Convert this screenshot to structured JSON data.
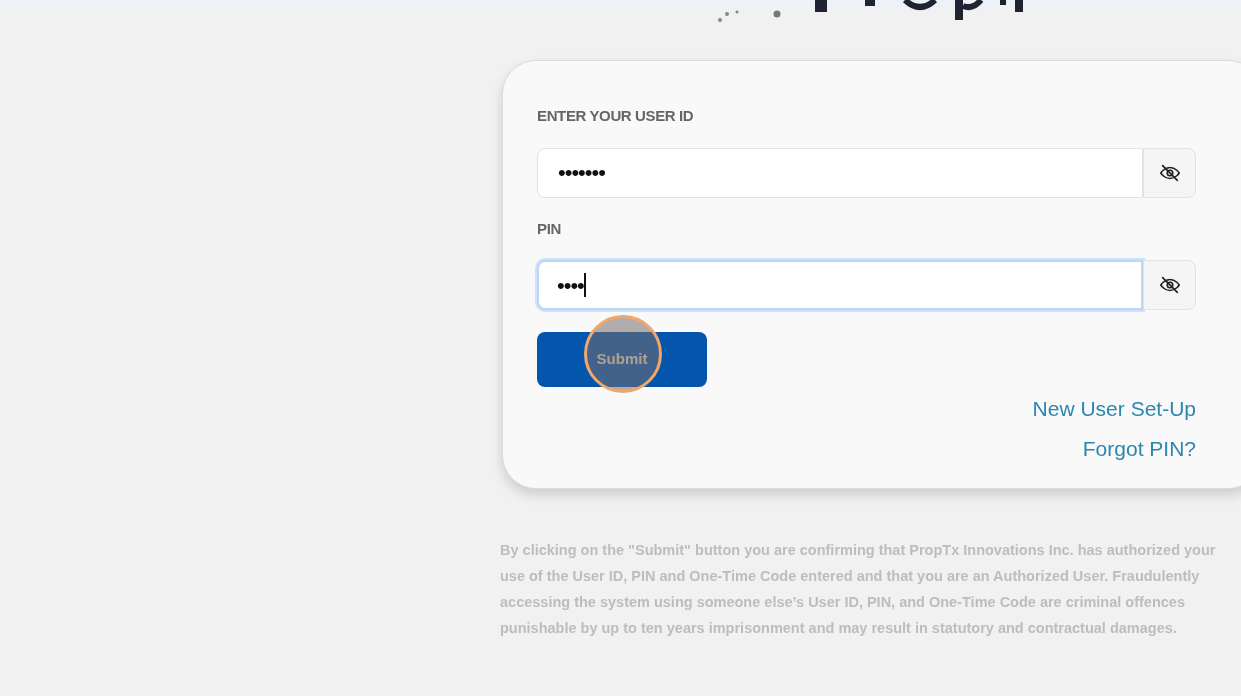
{
  "login_form": {
    "fields": [
      {
        "label": "ENTER YOUR USER ID",
        "value": "•••••••",
        "focused": false
      },
      {
        "label": "PIN",
        "value": "••••",
        "focused": true
      }
    ],
    "submit_button": "Submit",
    "links": [
      "New User Set-Up",
      "Forgot PIN?"
    ]
  },
  "disclaimer": "By clicking on the \"Submit\" button you are confirming that PropTx Innovations Inc. has authorized your use of the User ID, PIN and One-Time Code entered and that you are an Authorized User. Fraudulently accessing the system using someone else’s User ID, PIN, and One-Time Code are criminal offences punishable by up to ten years imprisonment and may result in statutory and contractual damages."
}
